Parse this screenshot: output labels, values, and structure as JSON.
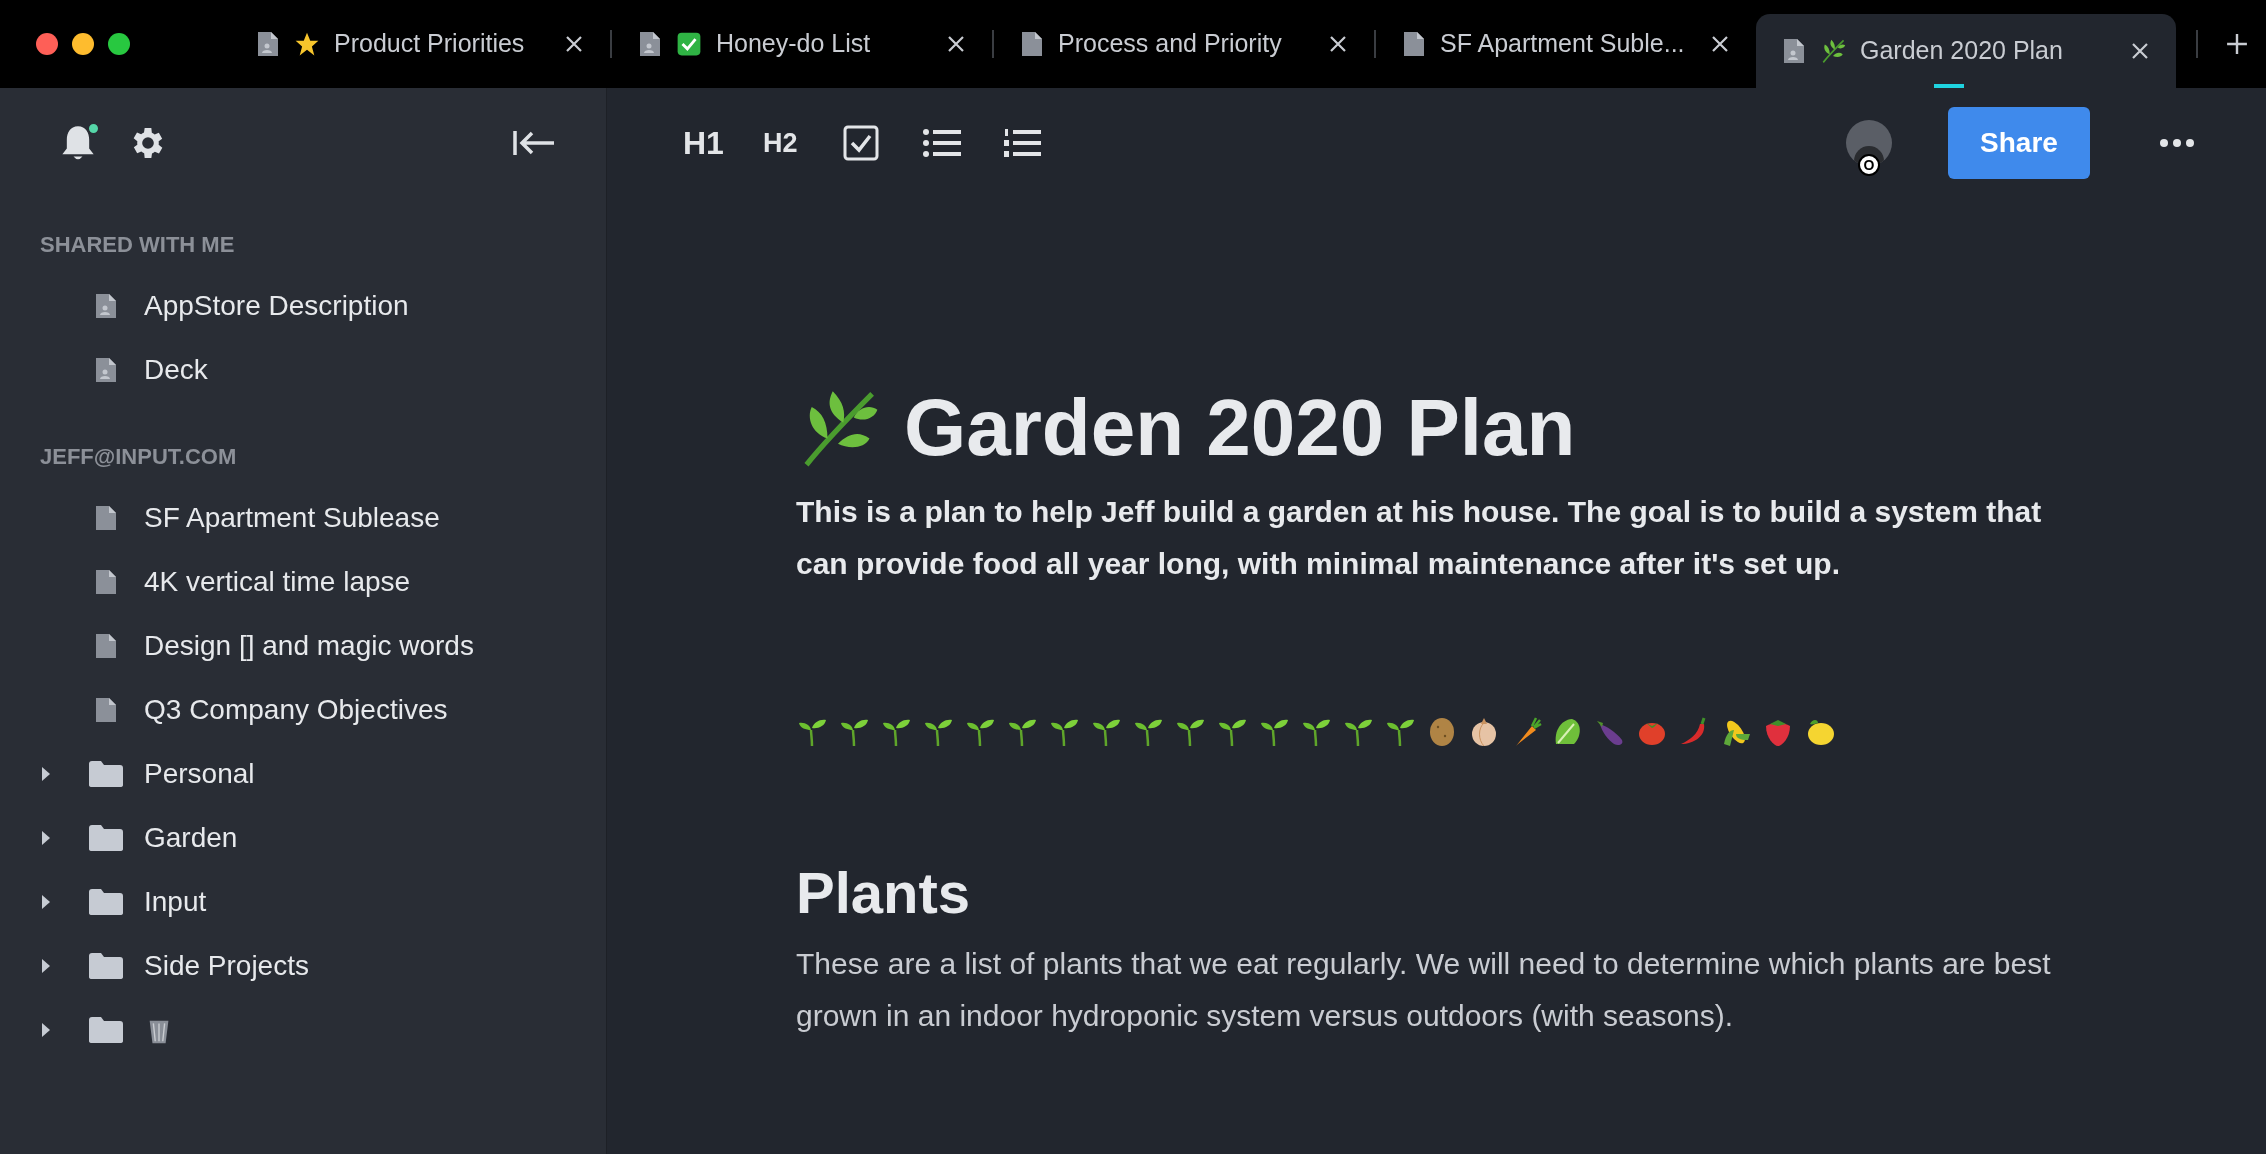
{
  "tabs": [
    {
      "label": "Product Priorities",
      "emoji": {
        "kind": "star"
      },
      "selected": false
    },
    {
      "label": "Honey-do List",
      "emoji": {
        "kind": "check"
      },
      "selected": false
    },
    {
      "label": "Process and Priority",
      "selected": false
    },
    {
      "label": "SF Apartment Suble...",
      "selected": false
    },
    {
      "label": "Garden 2020 Plan",
      "emoji": {
        "kind": "leaf"
      },
      "selected": true
    }
  ],
  "sidebar": {
    "notification": true,
    "sections": [
      {
        "title": "SHARED WITH ME",
        "items": [
          {
            "kind": "shared_doc",
            "label": "AppStore Description"
          },
          {
            "kind": "shared_doc",
            "label": "Deck"
          }
        ]
      },
      {
        "title": "JEFF@INPUT.COM",
        "items": [
          {
            "kind": "doc",
            "label": "SF Apartment Sublease"
          },
          {
            "kind": "doc",
            "label": "4K vertical time lapse"
          },
          {
            "kind": "doc",
            "label": "Design [] and magic words"
          },
          {
            "kind": "doc",
            "label": "Q3 Company Objectives"
          },
          {
            "kind": "folder",
            "label": "Personal",
            "expanded": false
          },
          {
            "kind": "folder",
            "label": "Garden",
            "expanded": false
          },
          {
            "kind": "folder",
            "label": "Input",
            "expanded": false
          },
          {
            "kind": "folder",
            "label": "Side Projects",
            "expanded": false
          },
          {
            "kind": "folder",
            "emoji": {
              "kind": "trash"
            },
            "expanded": false
          }
        ]
      }
    ]
  },
  "toolbar": {
    "h1": "H1",
    "h2": "H2",
    "avatar_badge": "O",
    "share": "Share"
  },
  "document": {
    "title_emoji": {
      "kind": "leaf"
    },
    "title": "Garden 2020 Plan",
    "intro": "This is a plan to help Jeff build a garden at his house. The goal is to build a system that can provide food all year long, with minimal maintenance after it's set up.",
    "emoji_row": [
      {
        "kind": "seedling"
      },
      {
        "kind": "seedling"
      },
      {
        "kind": "seedling"
      },
      {
        "kind": "seedling"
      },
      {
        "kind": "seedling"
      },
      {
        "kind": "seedling"
      },
      {
        "kind": "seedling"
      },
      {
        "kind": "seedling"
      },
      {
        "kind": "seedling"
      },
      {
        "kind": "seedling"
      },
      {
        "kind": "seedling"
      },
      {
        "kind": "seedling"
      },
      {
        "kind": "seedling"
      },
      {
        "kind": "seedling"
      },
      {
        "kind": "seedling"
      },
      {
        "kind": "potato"
      },
      {
        "kind": "onion"
      },
      {
        "kind": "carrot"
      },
      {
        "kind": "lettuce"
      },
      {
        "kind": "eggplant"
      },
      {
        "kind": "tomato"
      },
      {
        "kind": "pepper"
      },
      {
        "kind": "corn"
      },
      {
        "kind": "strawberry"
      },
      {
        "kind": "lemon"
      }
    ],
    "heading": "Plants",
    "body": "These are a list of plants that we eat regularly. We will need to determine which plants are best grown in an indoor hydroponic system versus outdoors (with seasons)."
  }
}
